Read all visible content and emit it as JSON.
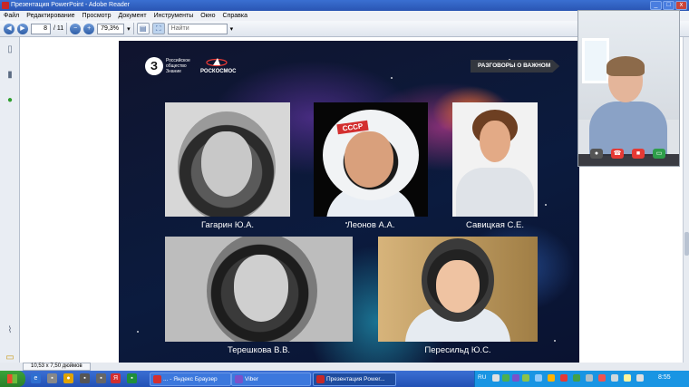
{
  "window": {
    "title": "Презентация PowerPoint - Adobe Reader",
    "minimize": "_",
    "maximize": "□",
    "close": "x"
  },
  "menu": [
    "Файл",
    "Редактирование",
    "Просмотр",
    "Документ",
    "Инструменты",
    "Окно",
    "Справка"
  ],
  "toolbar": {
    "page_current": "8",
    "page_sep": "/ 11",
    "zoom": "79,3%",
    "search_placeholder": "Найти"
  },
  "slide": {
    "logo_z": "З",
    "logo_znanie": "Российское общество Знание",
    "logo_roscosmos": "РОСКОСМОС",
    "badge": "РАЗГОВОРЫ О ВАЖНОМ",
    "portraits": [
      {
        "name": "Гагарин Ю.А."
      },
      {
        "name": "Леонов А.А."
      },
      {
        "name": "Савицкая С.Е."
      },
      {
        "name": "Терешкова В.В."
      },
      {
        "name": "Пересильд Ю.С."
      }
    ],
    "helmet_text": "СССР"
  },
  "status": {
    "page_size": "10,53 x 7,50 дюймов"
  },
  "taskbar": {
    "tasks": [
      {
        "label": "... - Яндекс Браузер"
      },
      {
        "label": "Viber"
      },
      {
        "label": "Презентация Power..."
      }
    ],
    "lang": "RU",
    "clock": "8:55"
  },
  "colors": {
    "taskbar": "#2251b5",
    "tray": "#1995e3",
    "badge": "#33373f"
  }
}
